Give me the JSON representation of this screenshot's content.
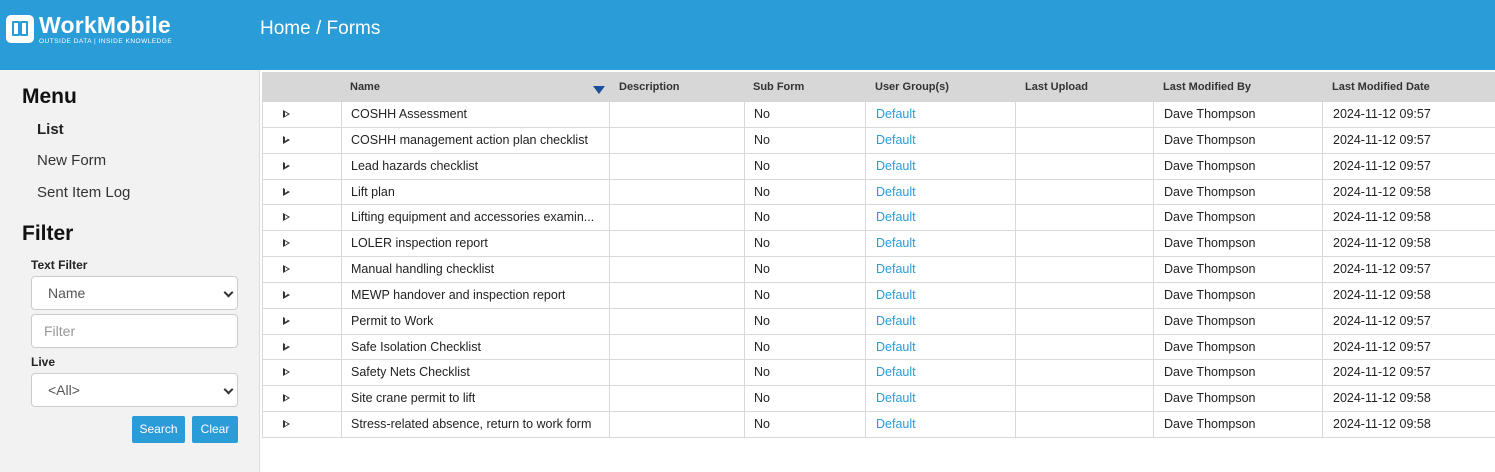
{
  "brand": {
    "name": "WorkMobile",
    "tagline": "OUTSIDE DATA | INSIDE KNOWLEDGE"
  },
  "breadcrumb": "Home / Forms",
  "colors": {
    "header": "#2a9cd8",
    "link": "#2a9cd8",
    "sort_indicator": "#1a4f9c"
  },
  "sidebar": {
    "menu_title": "Menu",
    "menu": [
      {
        "label": "List",
        "active": true
      },
      {
        "label": "New Form",
        "active": false
      },
      {
        "label": "Sent Item Log",
        "active": false
      }
    ],
    "filter_title": "Filter",
    "text_filter_label": "Text Filter",
    "text_filter_select": "Name",
    "filter_placeholder": "Filter",
    "live_label": "Live",
    "live_select": "<All>",
    "search_button": "Search",
    "clear_button": "Clear"
  },
  "table": {
    "columns": [
      "Name",
      "Description",
      "Sub Form",
      "User Group(s)",
      "Last Upload",
      "Last Modified By",
      "Last Modified Date"
    ],
    "sort": {
      "column": "Name",
      "direction": "descending",
      "icon": "sort-down-triangle-icon"
    },
    "rows": [
      {
        "name": "COSHH Assessment",
        "description": "",
        "sub_form": "No",
        "user_groups": "Default",
        "last_upload": "",
        "modified_by": "Dave Thompson",
        "modified_date": "2024-11-12 09:57"
      },
      {
        "name": "COSHH management action plan checklist",
        "description": "",
        "sub_form": "No",
        "user_groups": "Default",
        "last_upload": "",
        "modified_by": "Dave Thompson",
        "modified_date": "2024-11-12 09:57"
      },
      {
        "name": "Lead hazards checklist",
        "description": "",
        "sub_form": "No",
        "user_groups": "Default",
        "last_upload": "",
        "modified_by": "Dave Thompson",
        "modified_date": "2024-11-12 09:57"
      },
      {
        "name": "Lift plan",
        "description": "",
        "sub_form": "No",
        "user_groups": "Default",
        "last_upload": "",
        "modified_by": "Dave Thompson",
        "modified_date": "2024-11-12 09:58"
      },
      {
        "name": "Lifting equipment and accessories examin...",
        "description": "",
        "sub_form": "No",
        "user_groups": "Default",
        "last_upload": "",
        "modified_by": "Dave Thompson",
        "modified_date": "2024-11-12 09:58"
      },
      {
        "name": "LOLER inspection report",
        "description": "",
        "sub_form": "No",
        "user_groups": "Default",
        "last_upload": "",
        "modified_by": "Dave Thompson",
        "modified_date": "2024-11-12 09:58"
      },
      {
        "name": "Manual handling checklist",
        "description": "",
        "sub_form": "No",
        "user_groups": "Default",
        "last_upload": "",
        "modified_by": "Dave Thompson",
        "modified_date": "2024-11-12 09:57"
      },
      {
        "name": "MEWP handover and inspection report",
        "description": "",
        "sub_form": "No",
        "user_groups": "Default",
        "last_upload": "",
        "modified_by": "Dave Thompson",
        "modified_date": "2024-11-12 09:58"
      },
      {
        "name": "Permit to Work",
        "description": "",
        "sub_form": "No",
        "user_groups": "Default",
        "last_upload": "",
        "modified_by": "Dave Thompson",
        "modified_date": "2024-11-12 09:57"
      },
      {
        "name": "Safe Isolation Checklist",
        "description": "",
        "sub_form": "No",
        "user_groups": "Default",
        "last_upload": "",
        "modified_by": "Dave Thompson",
        "modified_date": "2024-11-12 09:57"
      },
      {
        "name": "Safety Nets Checklist",
        "description": "",
        "sub_form": "No",
        "user_groups": "Default",
        "last_upload": "",
        "modified_by": "Dave Thompson",
        "modified_date": "2024-11-12 09:57"
      },
      {
        "name": "Site crane permit to lift",
        "description": "",
        "sub_form": "No",
        "user_groups": "Default",
        "last_upload": "",
        "modified_by": "Dave Thompson",
        "modified_date": "2024-11-12 09:58"
      },
      {
        "name": "Stress-related absence, return to work form",
        "description": "",
        "sub_form": "No",
        "user_groups": "Default",
        "last_upload": "",
        "modified_by": "Dave Thompson",
        "modified_date": "2024-11-12 09:58"
      }
    ]
  }
}
